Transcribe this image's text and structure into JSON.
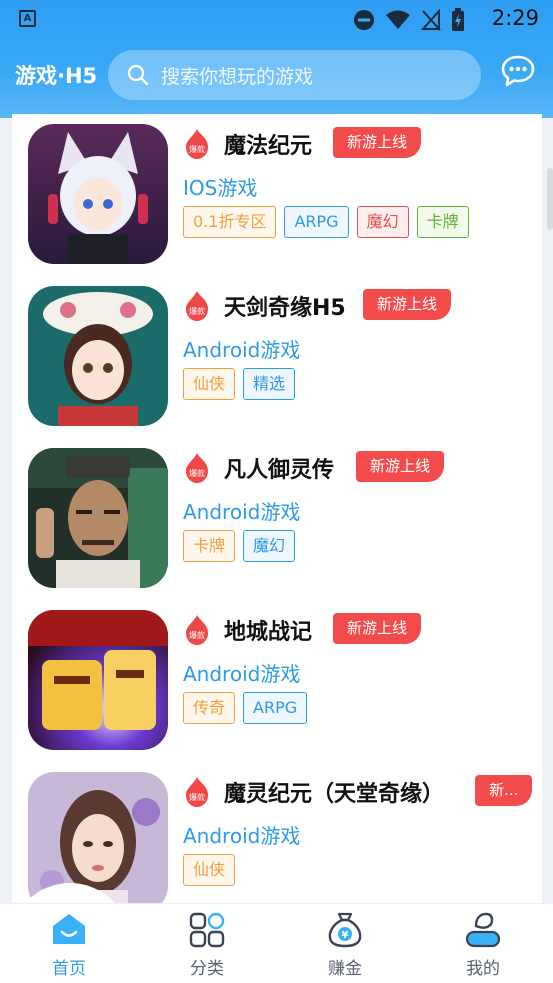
{
  "status_bar": {
    "time": "2:29",
    "app_icon_letter": "A"
  },
  "header": {
    "brand": "游戏·H5",
    "search_placeholder": "搜索你想玩的游戏"
  },
  "games": [
    {
      "name": "魔法纪元",
      "new_label": "新游上线",
      "platform": "IOS游戏",
      "tags": [
        {
          "text": "0.1折专区",
          "color": "#f0a040"
        },
        {
          "text": "ARPG",
          "color": "#2e9be6"
        },
        {
          "text": "魔幻",
          "color": "#e05252"
        },
        {
          "text": "卡牌",
          "color": "#62b338"
        }
      ]
    },
    {
      "name": "天剑奇缘H5",
      "new_label": "新游上线",
      "platform": "Android游戏",
      "tags": [
        {
          "text": "仙侠",
          "color": "#f0a040"
        },
        {
          "text": "精选",
          "color": "#2e9be6"
        }
      ]
    },
    {
      "name": "凡人御灵传",
      "new_label": "新游上线",
      "platform": "Android游戏",
      "tags": [
        {
          "text": "卡牌",
          "color": "#f0a040"
        },
        {
          "text": "魔幻",
          "color": "#2e9be6"
        }
      ]
    },
    {
      "name": "地城战记",
      "new_label": "新游上线",
      "platform": "Android游戏",
      "tags": [
        {
          "text": "传奇",
          "color": "#f0a040"
        },
        {
          "text": "ARPG",
          "color": "#2e9be6"
        }
      ]
    },
    {
      "name": "魔灵纪元（天堂奇缘）",
      "new_label": "新...",
      "platform": "Android游戏",
      "tags": [
        {
          "text": "仙侠",
          "color": "#f0a040"
        }
      ]
    }
  ],
  "hot_badge_text": "爆款",
  "bottom_nav": [
    {
      "label": "首页",
      "active": true
    },
    {
      "label": "分类",
      "active": false
    },
    {
      "label": "赚金",
      "active": false
    },
    {
      "label": "我的",
      "active": false
    }
  ],
  "colors": {
    "accent": "#2e9be6",
    "new_tag": "#f24b4b",
    "hot_badge": "#f04848"
  }
}
